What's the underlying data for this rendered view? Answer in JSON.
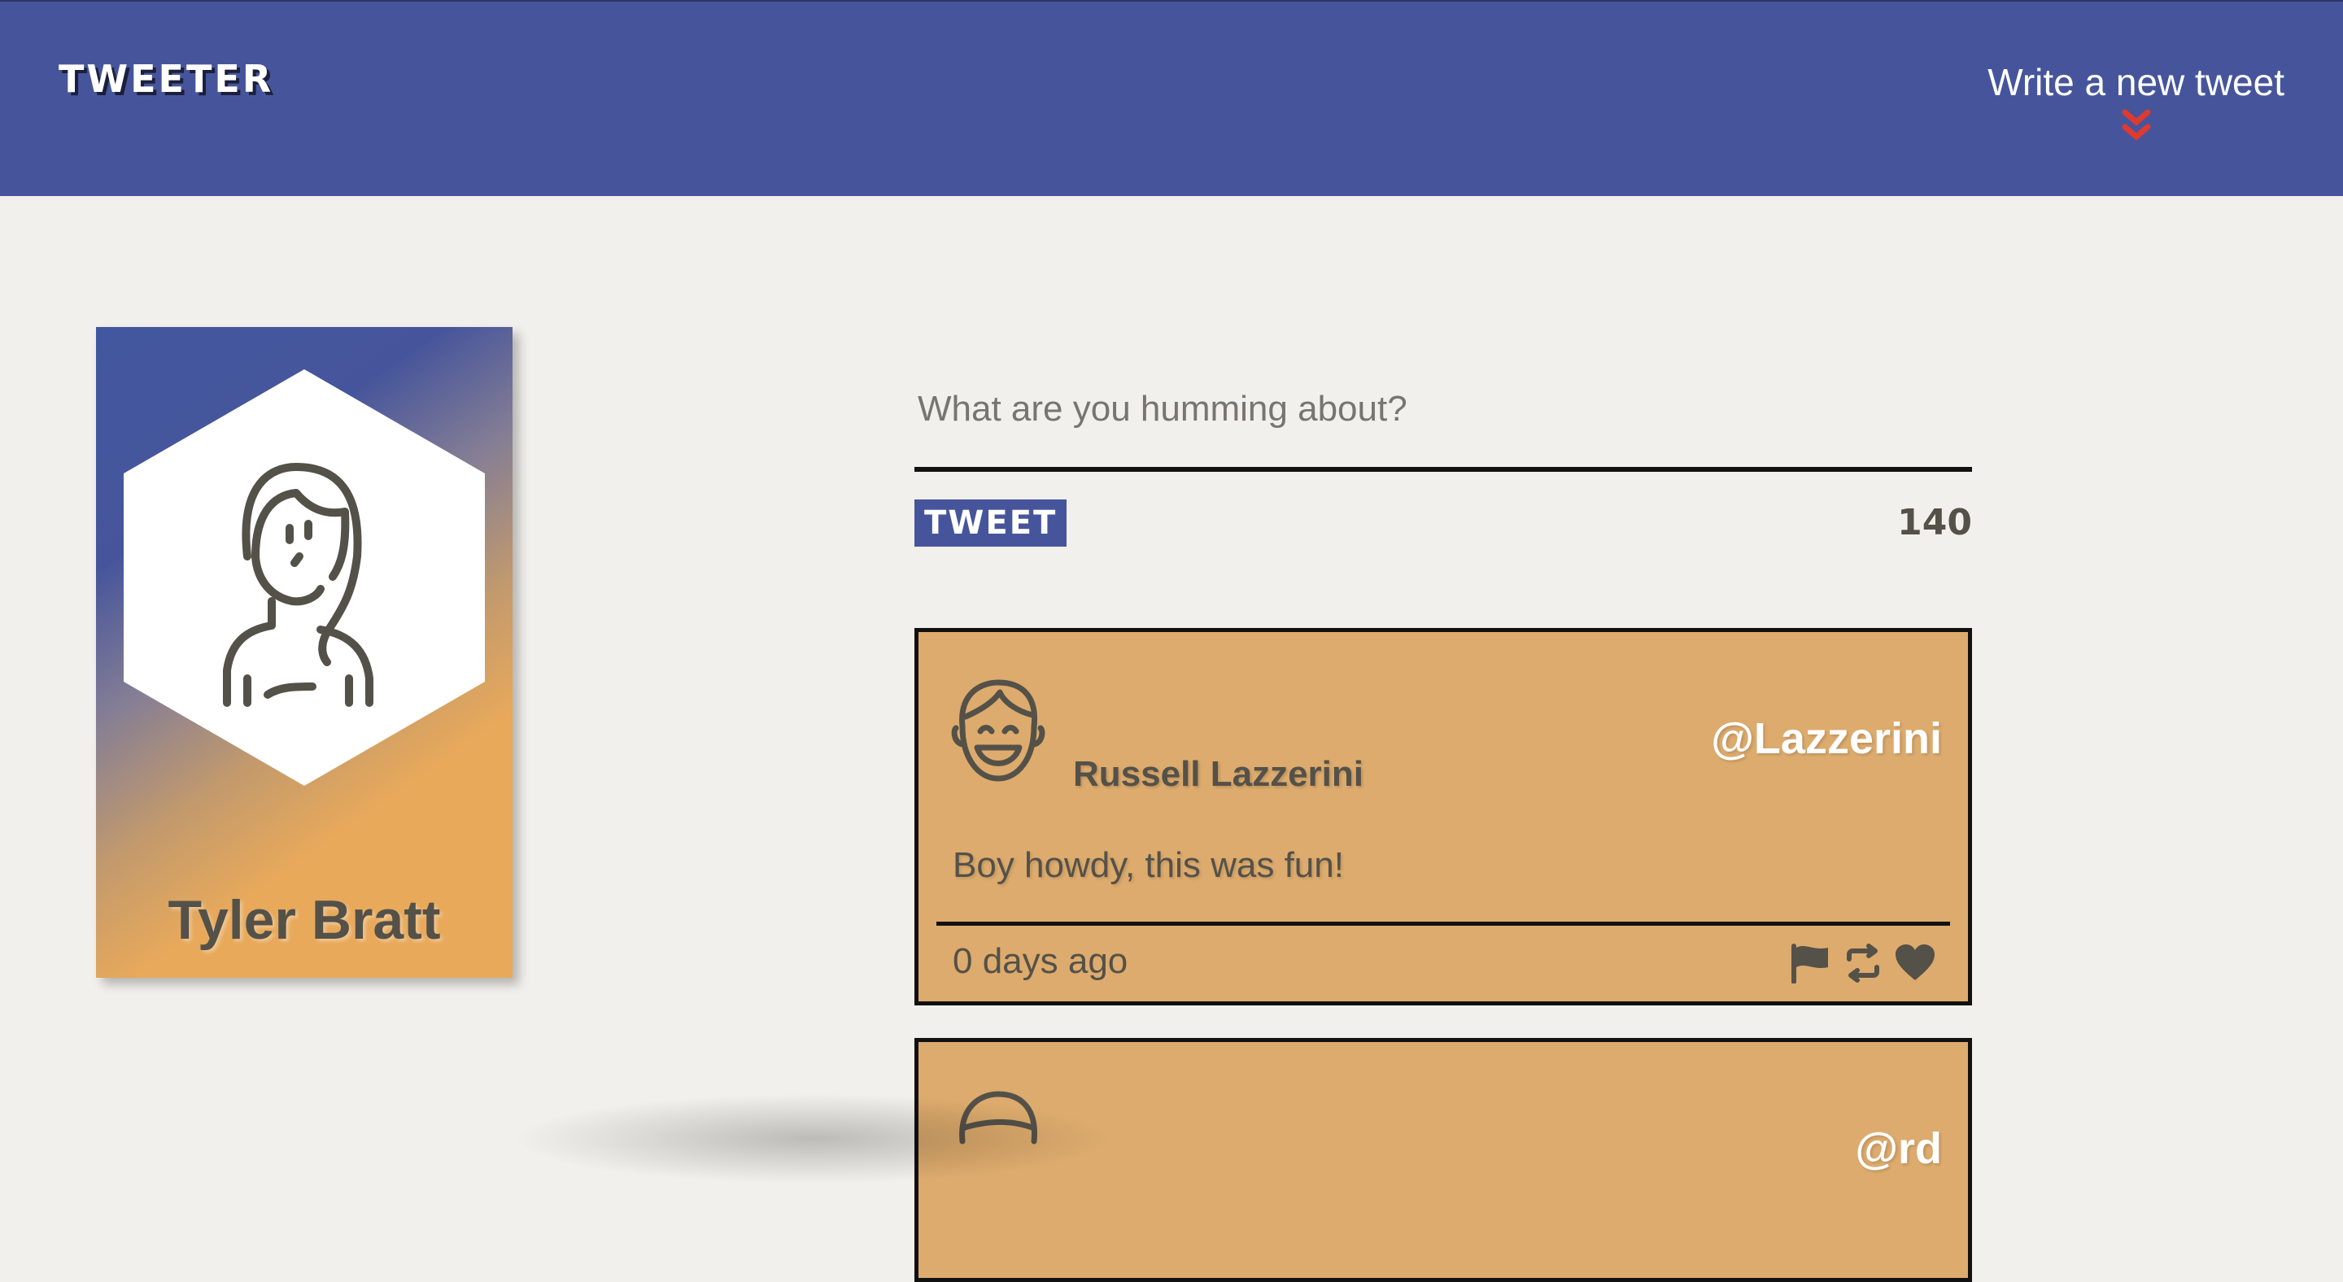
{
  "nav": {
    "brand": "TWEETER",
    "compose_toggle_label": "Write a new tweet",
    "toggle_icon": "double-chevron-down-icon",
    "accent_color": "#e03a2f"
  },
  "profile": {
    "name": "Tyler Bratt",
    "avatar_icon": "female-avatar-icon"
  },
  "compose": {
    "placeholder": "What are you humming about?",
    "value": "",
    "submit_label": "TWEET",
    "char_count": "140"
  },
  "tweets": [
    {
      "name": "Russell Lazzerini",
      "handle": "@Lazzerini",
      "content": "Boy howdy, this was fun!",
      "time": "0 days ago",
      "avatar_icon": "male-avatar-icon",
      "actions": [
        "flag-icon",
        "retweet-icon",
        "heart-icon"
      ]
    },
    {
      "handle": "@rd",
      "avatar_icon": "avatar-icon"
    }
  ],
  "colors": {
    "nav_bg": "#46559b",
    "page_bg": "#f2f0ec",
    "tweet_bg": "#ddab6d",
    "text": "#545149",
    "profile_gradient_end": "#e8a95b"
  }
}
